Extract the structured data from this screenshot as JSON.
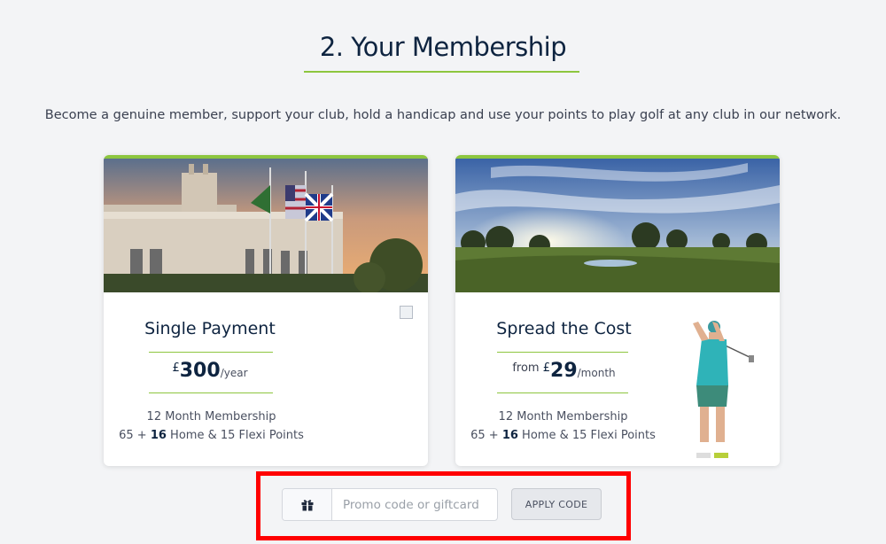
{
  "section": {
    "heading": "2. Your Membership",
    "intro": "Become a genuine member, support your club, hold a handicap and use your points to play golf at any club in our network."
  },
  "plans": [
    {
      "title": "Single Payment",
      "price_prefix": "",
      "currency": "£",
      "amount": "300",
      "period": "/year",
      "term": "12 Month Membership",
      "points_base": "65 + ",
      "points_bonus": "16",
      "points_rest": " Home & 15 Flexi Points",
      "image": "clubhouse-with-flags-photo"
    },
    {
      "title": "Spread the Cost",
      "price_prefix": "from ",
      "currency": "£",
      "amount": "29",
      "period": "/month",
      "term": "12 Month Membership",
      "points_base": "65 + ",
      "points_bonus": "16",
      "points_rest": " Home & 15 Flexi Points",
      "image": "golf-course-sunset-photo"
    }
  ],
  "promo": {
    "icon": "gift-icon",
    "placeholder": "Promo code or giftcard",
    "button_label": "APPLY CODE"
  },
  "colors": {
    "accent_green": "#8dc63f",
    "heading_navy": "#0e2440",
    "highlight_red": "#ff0000"
  }
}
